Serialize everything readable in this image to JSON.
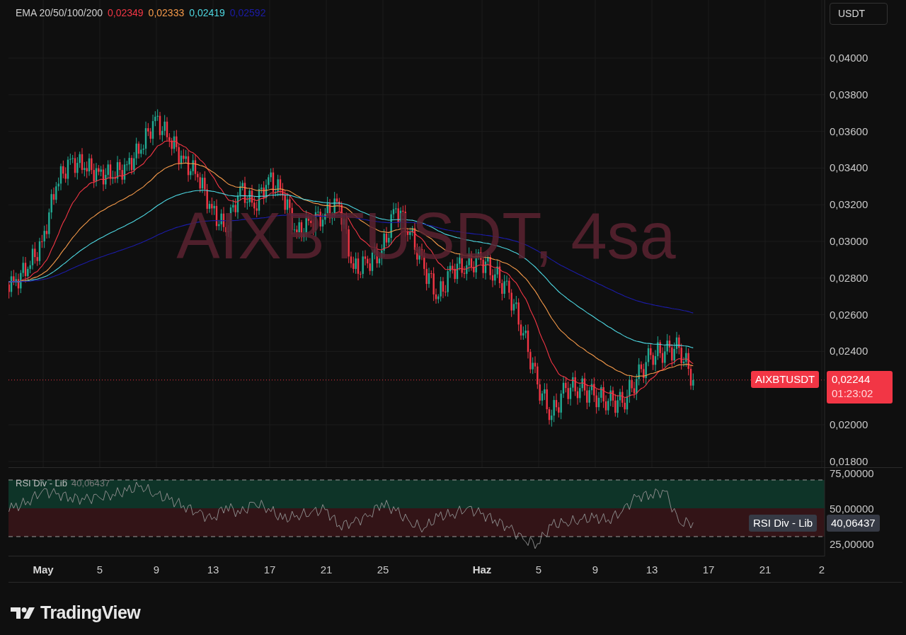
{
  "legend": {
    "title": "EMA 20/50/100/200",
    "values": [
      {
        "text": "0,02349",
        "color": "#f23645"
      },
      {
        "text": "0,02333",
        "color": "#f59a4a"
      },
      {
        "text": "0,02419",
        "color": "#4dd6e0"
      },
      {
        "text": "0,02592",
        "color": "#1c1ca8"
      }
    ]
  },
  "currency_button": "USDT",
  "watermark": "AIXBTUSDT, 4sa",
  "price_axis": [
    "0,04000",
    "0,03800",
    "0,03600",
    "0,03400",
    "0,03200",
    "0,03000",
    "0,02800",
    "0,02600",
    "0,02400",
    "0,02000",
    "0,01800"
  ],
  "last_price": {
    "symbol": "AIXBTUSDT",
    "price": "0,02244",
    "countdown": "01:23:02"
  },
  "rsi_pane": {
    "title": "RSI Div - Lib",
    "value_text": "40,06437",
    "axis": [
      "75,00000",
      "50,00000",
      "25,00000"
    ],
    "badge": {
      "name": "RSI Div - Lib",
      "value": "40,06437"
    }
  },
  "time_axis": [
    {
      "label": "May",
      "kind": "month"
    },
    {
      "label": "5",
      "kind": "day"
    },
    {
      "label": "9",
      "kind": "day"
    },
    {
      "label": "13",
      "kind": "day"
    },
    {
      "label": "17",
      "kind": "day"
    },
    {
      "label": "21",
      "kind": "day"
    },
    {
      "label": "25",
      "kind": "day"
    },
    {
      "label": "Haz",
      "kind": "month"
    },
    {
      "label": "5",
      "kind": "day"
    },
    {
      "label": "9",
      "kind": "day"
    },
    {
      "label": "13",
      "kind": "day"
    },
    {
      "label": "17",
      "kind": "day"
    },
    {
      "label": "21",
      "kind": "day"
    },
    {
      "label": "2",
      "kind": "day"
    }
  ],
  "logo": "TradingView"
}
